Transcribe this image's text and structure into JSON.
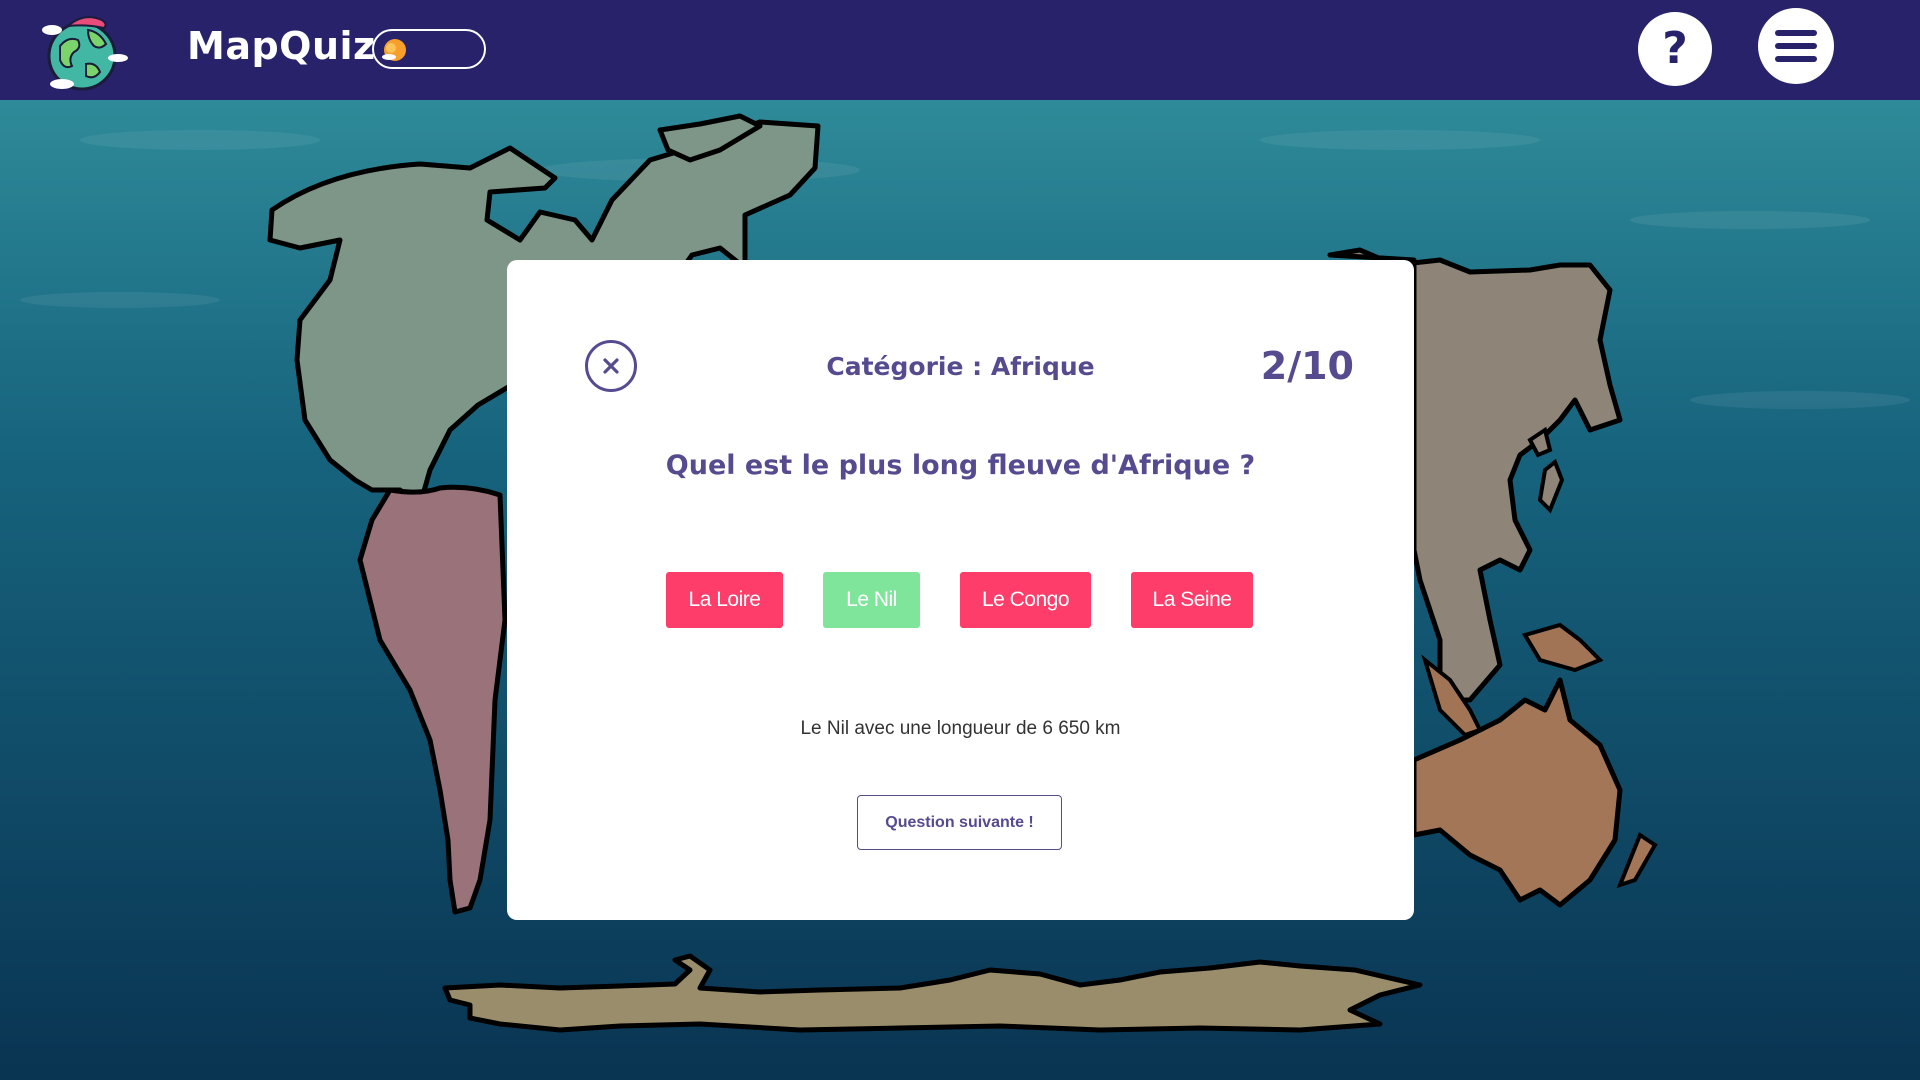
{
  "header": {
    "app_title": "MapQuiz",
    "logo_icon": "globe-logo-icon",
    "theme_toggle_icon": "sun-icon",
    "help_label": "?",
    "menu_icon": "hamburger-menu-icon"
  },
  "quiz": {
    "category": "Catégorie : Afrique",
    "counter": "2/10",
    "question": "Quel est le plus long fleuve d'Afrique ?",
    "answers": [
      {
        "label": "La Loire",
        "state": "incorrect"
      },
      {
        "label": "Le Nil",
        "state": "correct"
      },
      {
        "label": "Le Congo",
        "state": "incorrect"
      },
      {
        "label": "La Seine",
        "state": "incorrect"
      }
    ],
    "explanation": "Le Nil avec une longueur de 6 650 km",
    "next_label": "Question suivante !",
    "close_icon": "close-circle-icon"
  },
  "colors": {
    "header_bg": "#27226a",
    "accent_purple": "#574b90",
    "answer_default": "#fe3d6a",
    "answer_correct": "#7ee59b",
    "ocean_top": "#2a7f8f",
    "ocean_bottom": "#0a3a5a"
  }
}
